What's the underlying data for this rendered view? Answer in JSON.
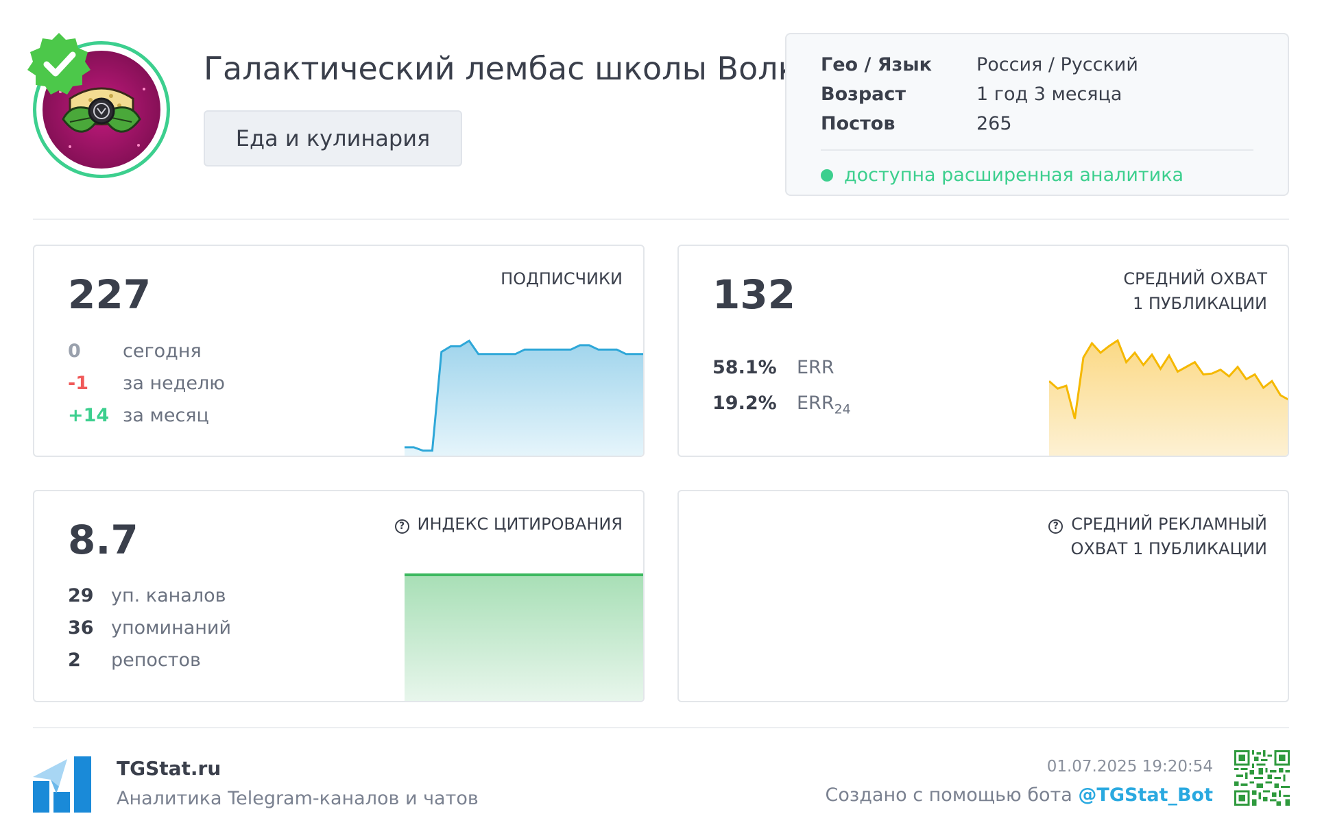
{
  "channel": {
    "title": "Галактический лембас школы Волка",
    "category": "Еда и кулинария"
  },
  "info": {
    "geo_label": "Гео / Язык",
    "geo_value": "Россия / Русский",
    "age_label": "Возраст",
    "age_value": "1 год 3 месяца",
    "posts_label": "Постов",
    "posts_value": "265",
    "analytics_text": "доступна расширенная аналитика"
  },
  "subscribers": {
    "label": "ПОДПИСЧИКИ",
    "value": "227",
    "rows": [
      {
        "num": "0",
        "text": "сегодня"
      },
      {
        "num": "-1",
        "text": "за неделю"
      },
      {
        "num": "+14",
        "text": "за месяц"
      }
    ]
  },
  "reach": {
    "label_line1": "СРЕДНИЙ ОХВАТ",
    "label_line2": "1 ПУБЛИКАЦИИ",
    "value": "132",
    "rows": [
      {
        "num": "58.1%",
        "text": "ERR",
        "sub": ""
      },
      {
        "num": "19.2%",
        "text": "ERR",
        "sub": "24"
      }
    ]
  },
  "citation": {
    "label": "ИНДЕКС ЦИТИРОВАНИЯ",
    "value": "8.7",
    "rows": [
      {
        "num": "29",
        "text": "уп. каналов"
      },
      {
        "num": "36",
        "text": "упоминаний"
      },
      {
        "num": "2",
        "text": "репостов"
      }
    ]
  },
  "ad_reach": {
    "label_line1": "СРЕДНИЙ РЕКЛАМНЫЙ",
    "label_line2": "ОХВАТ 1 ПУБЛИКАЦИИ"
  },
  "footer": {
    "brand": "TGStat.ru",
    "tagline": "Аналитика Telegram-каналов и чатов",
    "date": "01.07.2025 19:20:54",
    "bot_prefix": "Создано с помощью бота ",
    "bot_handle": "@TGStat_Bot"
  },
  "colors": {
    "accent_green": "#3ccf8e",
    "negative": "#f05a5a",
    "subscribers_line": "#2ea7d8",
    "reach_line": "#f5b800",
    "citation_line": "#3cb85f",
    "link": "#2aa9e0"
  },
  "icons": {
    "verified": "verified-check-icon",
    "help": "question-circle-icon",
    "logo": "tgstat-logo-icon",
    "qr": "qr-code-icon"
  },
  "sparklines": {
    "subscribers": [
      5,
      5,
      2,
      2,
      91,
      96,
      96,
      101,
      89,
      89,
      89,
      89,
      89,
      93,
      93,
      93,
      93,
      93,
      93,
      97,
      97,
      93,
      93,
      93,
      89,
      89,
      89
    ],
    "reach": [
      60,
      52,
      55,
      20,
      85,
      100,
      90,
      97,
      103,
      80,
      90,
      77,
      88,
      73,
      87,
      70,
      75,
      80,
      67,
      68,
      72,
      65,
      75,
      62,
      67,
      53,
      60,
      45,
      40
    ],
    "citation": [
      100,
      100
    ]
  }
}
